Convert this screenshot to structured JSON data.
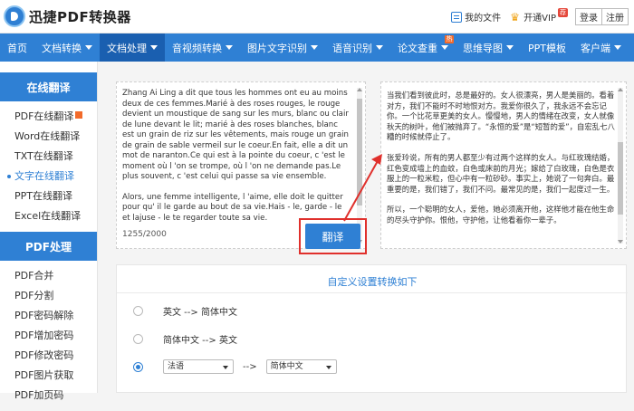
{
  "app": {
    "title": "迅捷PDF转换器"
  },
  "topbar": {
    "my_files": "我的文件",
    "vip": "开通VIP",
    "vip_badge": "荐",
    "login": "登录",
    "register": "注册"
  },
  "nav": [
    {
      "label": "首页",
      "caret": false,
      "active": false
    },
    {
      "label": "文档转换",
      "caret": true,
      "active": false
    },
    {
      "label": "文档处理",
      "caret": true,
      "active": true
    },
    {
      "label": "音视频转换",
      "caret": true,
      "active": false
    },
    {
      "label": "图片文字识别",
      "caret": true,
      "active": false
    },
    {
      "label": "语音识别",
      "caret": true,
      "active": false
    },
    {
      "label": "论文查重",
      "caret": true,
      "active": false,
      "hot": "热"
    },
    {
      "label": "思维导图",
      "caret": true,
      "active": false
    },
    {
      "label": "PPT模板",
      "caret": false,
      "active": false
    },
    {
      "label": "客户端",
      "caret": true,
      "active": false
    }
  ],
  "sidebar": {
    "section1": "在线翻译",
    "items1": [
      "PDF在线翻译",
      "Word在线翻译",
      "TXT在线翻译",
      "文字在线翻译",
      "PPT在线翻译",
      "Excel在线翻译"
    ],
    "section2": "PDF处理",
    "items2": [
      "PDF合并",
      "PDF分割",
      "PDF密码解除",
      "PDF增加密码",
      "PDF修改密码",
      "PDF图片获取",
      "PDF加页码"
    ]
  },
  "source": {
    "para1": "Zhang Ai Ling a dit que tous les hommes ont eu au moins deux de ces femmes.Marié à des roses rouges, le rouge devient un moustique de sang sur les murs, blanc ou clair de lune devant le lit; marié à des roses blanches, blanc est un grain de riz sur les vêtements, mais rouge un grain de grain de sable vermeil sur le coeur.En fait, elle a dit un mot de naranton.Ce qui est à la pointe du coeur, c 'est le moment où l 'on se trompe, où l 'on ne demande pas.Le plus souvent, c 'est celui qui passe sa vie ensemble.",
    "para2": "Alors, une femme intelligente, l 'aime, elle doit le quitter pour qu' il le garde au bout de sa vie.Hais - le, garde - le et lajuse - le te regarder toute sa vie.",
    "count": "1255/2000"
  },
  "result": {
    "para1": "当我们看到彼此时，总是最好的。女人很漂亮，男人是美丽的。看着对方，我们不能时不时地恨对方。我爱你很久了，我永远不会忘记你。一个比花草更美的女人。慢慢地，男人的情绪在改变，女人就像秋天的树叶，他们被抛弃了。“永恒的爱”是“短暂的爱”，自宏乱七八糟的时候就停止了。",
    "para2": "张爱玲说，所有的男人都至少有过两个这样的女人。与红玫瑰结婚，红色变成墙上的血蚊，白色或床前的月光；嫁给了白玫瑰，白色是衣服上的一粒米粒，但心中有一粒砂砂。事实上，她说了一句奔白。最重要的是，我们错了，我们不问。最常见的是，我们一起度过一生。",
    "para3": "所以，一个聪明的女人，爱他，她必须离开他，这样他才能在他生命的尽头守护你。恨他，守护他，让他看着你一辈子。"
  },
  "translate_button": "翻译",
  "settings": {
    "title": "自定义设置转换如下",
    "option1": "英文 --> 简体中文",
    "option2": "简体中文 --> 英文",
    "from_lang": "法语",
    "arrow": "-->",
    "to_lang": "简体中文"
  },
  "colors": {
    "primary": "#2f80d4",
    "highlight": "#e0302c"
  }
}
